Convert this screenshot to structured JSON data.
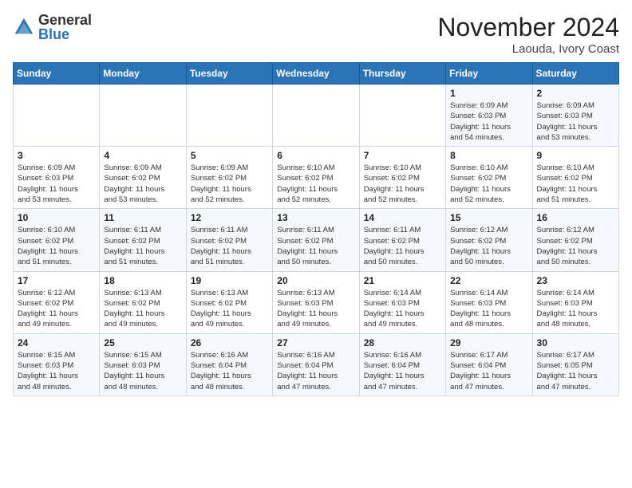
{
  "header": {
    "logo_general": "General",
    "logo_blue": "Blue",
    "month_title": "November 2024",
    "location": "Laouda, Ivory Coast"
  },
  "days_of_week": [
    "Sunday",
    "Monday",
    "Tuesday",
    "Wednesday",
    "Thursday",
    "Friday",
    "Saturday"
  ],
  "weeks": [
    [
      {
        "num": "",
        "info": ""
      },
      {
        "num": "",
        "info": ""
      },
      {
        "num": "",
        "info": ""
      },
      {
        "num": "",
        "info": ""
      },
      {
        "num": "",
        "info": ""
      },
      {
        "num": "1",
        "info": "Sunrise: 6:09 AM\nSunset: 6:03 PM\nDaylight: 11 hours\nand 54 minutes."
      },
      {
        "num": "2",
        "info": "Sunrise: 6:09 AM\nSunset: 6:03 PM\nDaylight: 11 hours\nand 53 minutes."
      }
    ],
    [
      {
        "num": "3",
        "info": "Sunrise: 6:09 AM\nSunset: 6:03 PM\nDaylight: 11 hours\nand 53 minutes."
      },
      {
        "num": "4",
        "info": "Sunrise: 6:09 AM\nSunset: 6:02 PM\nDaylight: 11 hours\nand 53 minutes."
      },
      {
        "num": "5",
        "info": "Sunrise: 6:09 AM\nSunset: 6:02 PM\nDaylight: 11 hours\nand 52 minutes."
      },
      {
        "num": "6",
        "info": "Sunrise: 6:10 AM\nSunset: 6:02 PM\nDaylight: 11 hours\nand 52 minutes."
      },
      {
        "num": "7",
        "info": "Sunrise: 6:10 AM\nSunset: 6:02 PM\nDaylight: 11 hours\nand 52 minutes."
      },
      {
        "num": "8",
        "info": "Sunrise: 6:10 AM\nSunset: 6:02 PM\nDaylight: 11 hours\nand 52 minutes."
      },
      {
        "num": "9",
        "info": "Sunrise: 6:10 AM\nSunset: 6:02 PM\nDaylight: 11 hours\nand 51 minutes."
      }
    ],
    [
      {
        "num": "10",
        "info": "Sunrise: 6:10 AM\nSunset: 6:02 PM\nDaylight: 11 hours\nand 51 minutes."
      },
      {
        "num": "11",
        "info": "Sunrise: 6:11 AM\nSunset: 6:02 PM\nDaylight: 11 hours\nand 51 minutes."
      },
      {
        "num": "12",
        "info": "Sunrise: 6:11 AM\nSunset: 6:02 PM\nDaylight: 11 hours\nand 51 minutes."
      },
      {
        "num": "13",
        "info": "Sunrise: 6:11 AM\nSunset: 6:02 PM\nDaylight: 11 hours\nand 50 minutes."
      },
      {
        "num": "14",
        "info": "Sunrise: 6:11 AM\nSunset: 6:02 PM\nDaylight: 11 hours\nand 50 minutes."
      },
      {
        "num": "15",
        "info": "Sunrise: 6:12 AM\nSunset: 6:02 PM\nDaylight: 11 hours\nand 50 minutes."
      },
      {
        "num": "16",
        "info": "Sunrise: 6:12 AM\nSunset: 6:02 PM\nDaylight: 11 hours\nand 50 minutes."
      }
    ],
    [
      {
        "num": "17",
        "info": "Sunrise: 6:12 AM\nSunset: 6:02 PM\nDaylight: 11 hours\nand 49 minutes."
      },
      {
        "num": "18",
        "info": "Sunrise: 6:13 AM\nSunset: 6:02 PM\nDaylight: 11 hours\nand 49 minutes."
      },
      {
        "num": "19",
        "info": "Sunrise: 6:13 AM\nSunset: 6:02 PM\nDaylight: 11 hours\nand 49 minutes."
      },
      {
        "num": "20",
        "info": "Sunrise: 6:13 AM\nSunset: 6:03 PM\nDaylight: 11 hours\nand 49 minutes."
      },
      {
        "num": "21",
        "info": "Sunrise: 6:14 AM\nSunset: 6:03 PM\nDaylight: 11 hours\nand 49 minutes."
      },
      {
        "num": "22",
        "info": "Sunrise: 6:14 AM\nSunset: 6:03 PM\nDaylight: 11 hours\nand 48 minutes."
      },
      {
        "num": "23",
        "info": "Sunrise: 6:14 AM\nSunset: 6:03 PM\nDaylight: 11 hours\nand 48 minutes."
      }
    ],
    [
      {
        "num": "24",
        "info": "Sunrise: 6:15 AM\nSunset: 6:03 PM\nDaylight: 11 hours\nand 48 minutes."
      },
      {
        "num": "25",
        "info": "Sunrise: 6:15 AM\nSunset: 6:03 PM\nDaylight: 11 hours\nand 48 minutes."
      },
      {
        "num": "26",
        "info": "Sunrise: 6:16 AM\nSunset: 6:04 PM\nDaylight: 11 hours\nand 48 minutes."
      },
      {
        "num": "27",
        "info": "Sunrise: 6:16 AM\nSunset: 6:04 PM\nDaylight: 11 hours\nand 47 minutes."
      },
      {
        "num": "28",
        "info": "Sunrise: 6:16 AM\nSunset: 6:04 PM\nDaylight: 11 hours\nand 47 minutes."
      },
      {
        "num": "29",
        "info": "Sunrise: 6:17 AM\nSunset: 6:04 PM\nDaylight: 11 hours\nand 47 minutes."
      },
      {
        "num": "30",
        "info": "Sunrise: 6:17 AM\nSunset: 6:05 PM\nDaylight: 11 hours\nand 47 minutes."
      }
    ]
  ]
}
